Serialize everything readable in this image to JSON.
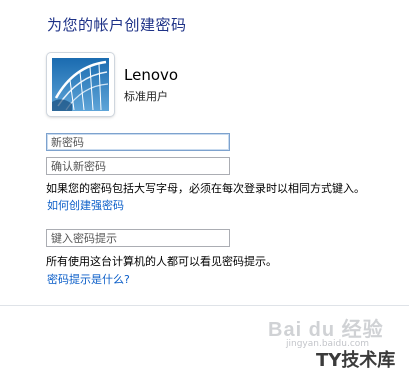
{
  "page": {
    "title": "为您的帐户创建密码"
  },
  "account": {
    "name": "Lenovo",
    "role": "标准用户"
  },
  "form": {
    "new_password_placeholder": "新密码",
    "confirm_password_placeholder": "确认新密码",
    "caps_note": "如果您的密码包括大写字母，必须在每次登录时以相同方式键入。",
    "strong_password_link": "如何创建强密码",
    "hint_placeholder": "键入密码提示",
    "hint_note": "所有使用这台计算机的人都可以看见密码提示。",
    "hint_link": "密码提示是什么?"
  },
  "watermark": {
    "baidu": "Bai du 经验",
    "url": "jingyan.baidu.com",
    "site": "TY技术库"
  },
  "colors": {
    "title": "#1e3287",
    "link": "#0b5ec8",
    "avatar_bg": "#1c6fb5"
  },
  "icons": {
    "avatar": "user-picture-icon"
  }
}
